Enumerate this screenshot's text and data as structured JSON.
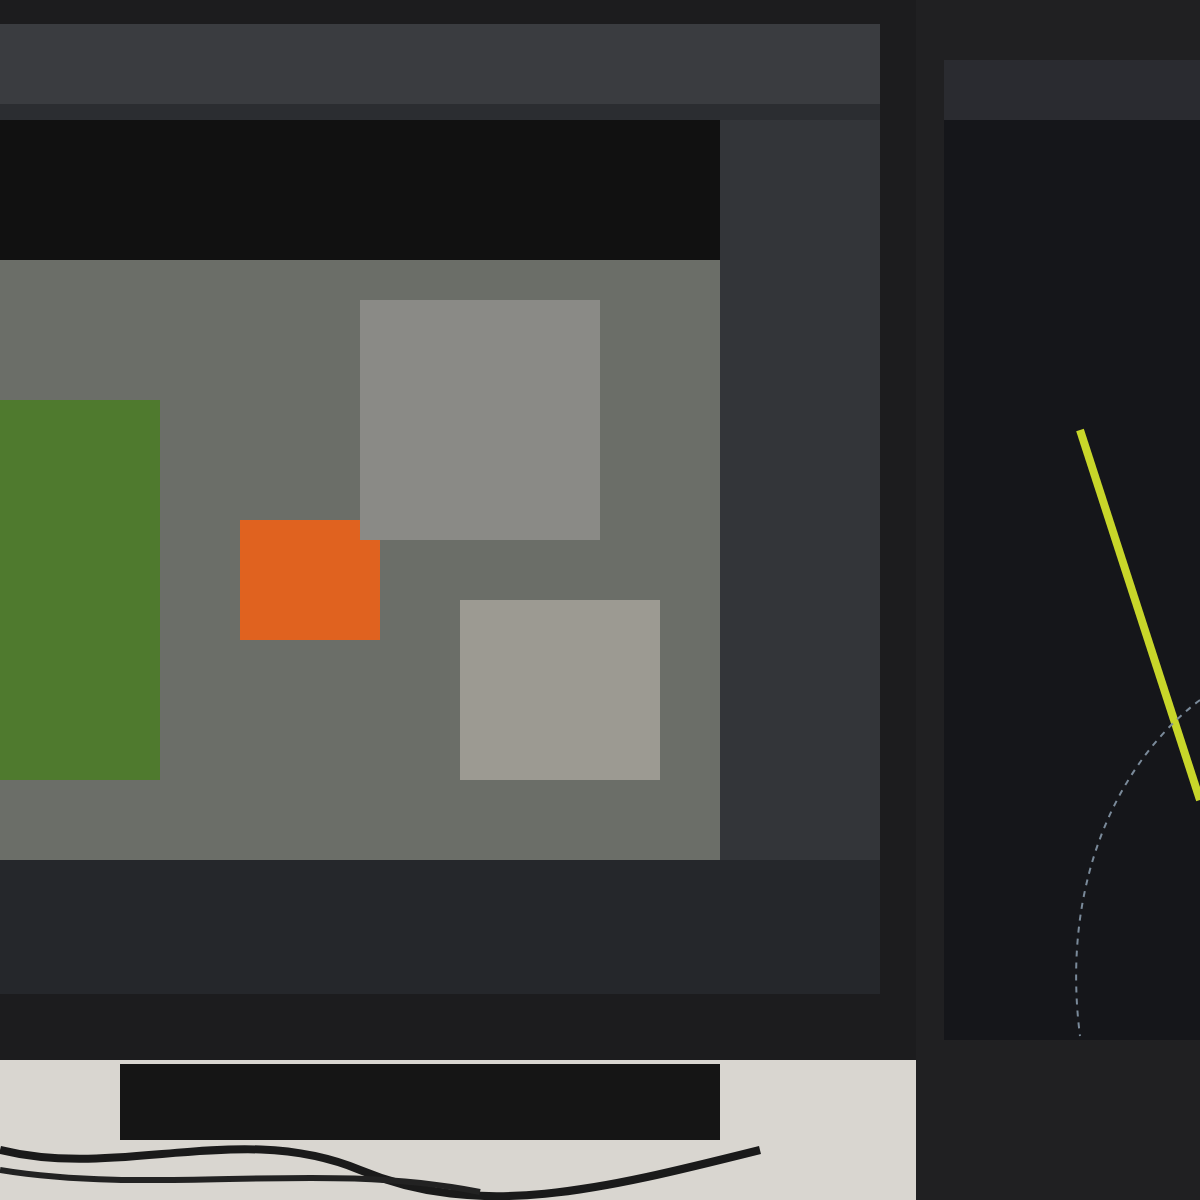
{
  "monitors": [
    {
      "kind": "wide"
    },
    {
      "kind": "tall"
    }
  ]
}
